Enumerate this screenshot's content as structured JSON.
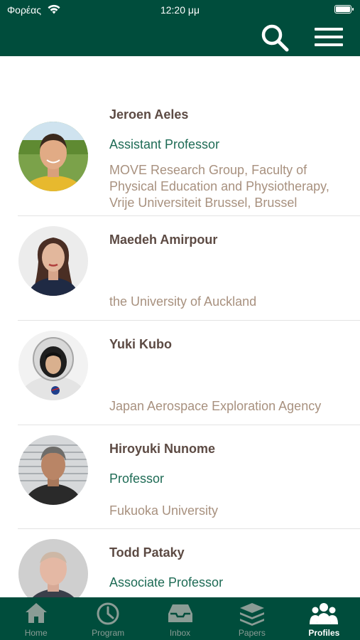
{
  "status_bar": {
    "carrier": "Φορέας",
    "time": "12:20 μμ"
  },
  "nav": {
    "search_icon": "search-icon",
    "menu_icon": "hamburger-menu-icon"
  },
  "profiles": [
    {
      "name": "Jeroen Aeles",
      "title": "Assistant Professor",
      "affiliation": "MOVE Research Group, Faculty of Physical Education and Physiotherapy, Vrije Universiteit Brussel, Brussel"
    },
    {
      "name": "Maedeh Amirpour",
      "title": "",
      "affiliation": "the University of Auckland"
    },
    {
      "name": "Yuki Kubo",
      "title": "",
      "affiliation": "Japan Aerospace Exploration Agency"
    },
    {
      "name": "Hiroyuki Nunome",
      "title": "Professor",
      "affiliation": "Fukuoka University"
    },
    {
      "name": "Todd Pataky",
      "title": "Associate Professor",
      "affiliation": ""
    }
  ],
  "tabs": [
    {
      "label": "Home",
      "icon": "home-icon",
      "active": false
    },
    {
      "label": "Program",
      "icon": "clock-icon",
      "active": false
    },
    {
      "label": "Inbox",
      "icon": "inbox-icon",
      "active": false
    },
    {
      "label": "Papers",
      "icon": "layers-icon",
      "active": false
    },
    {
      "label": "Profiles",
      "icon": "people-icon",
      "active": true
    }
  ],
  "colors": {
    "brand": "#004d3c",
    "name": "#5c4a43",
    "title": "#1e6b55",
    "affiliation": "#a8917f"
  }
}
